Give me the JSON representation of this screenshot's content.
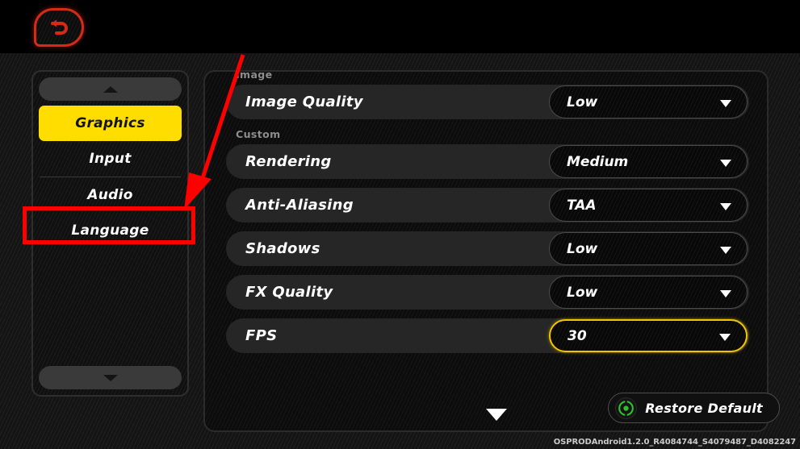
{
  "header": {
    "back_button": {
      "label": "Back",
      "icon": "back-arrow-icon"
    }
  },
  "sidebar": {
    "scroll_up": {
      "icon": "chevron-up-icon"
    },
    "scroll_down": {
      "icon": "chevron-down-icon"
    },
    "items": [
      {
        "label": "Graphics",
        "active": true
      },
      {
        "label": "Input",
        "active": false
      },
      {
        "label": "Audio",
        "active": false
      },
      {
        "label": "Language",
        "active": false
      }
    ]
  },
  "main": {
    "sections": [
      {
        "label": "Image",
        "rows": [
          {
            "label": "Image Quality",
            "value": "Low",
            "highlighted": false
          }
        ]
      },
      {
        "label": "Custom",
        "rows": [
          {
            "label": "Rendering",
            "value": "Medium",
            "highlighted": false
          },
          {
            "label": "Anti-Aliasing",
            "value": "TAA",
            "highlighted": false
          },
          {
            "label": "Shadows",
            "value": "Low",
            "highlighted": false
          },
          {
            "label": "FX Quality",
            "value": "Low",
            "highlighted": false
          },
          {
            "label": "FPS",
            "value": "30",
            "highlighted": true
          }
        ]
      }
    ],
    "scroll_down_icon": "chevron-down-icon"
  },
  "footer": {
    "restore_button": {
      "label": "Restore Default",
      "icon": "refresh-icon",
      "icon_color": "#2FBF2F"
    },
    "version": "OSPRODAndroid1.2.0_R4084744_S4079487_D4082247"
  },
  "annotation": {
    "highlight_color": "#FF0000",
    "arrow_color": "#FF0000",
    "target": "Language"
  },
  "colors": {
    "accent_yellow": "#FFDD00",
    "highlight_yellow": "#F2C400",
    "back_red": "#D42A16",
    "green": "#2FBF2F"
  }
}
